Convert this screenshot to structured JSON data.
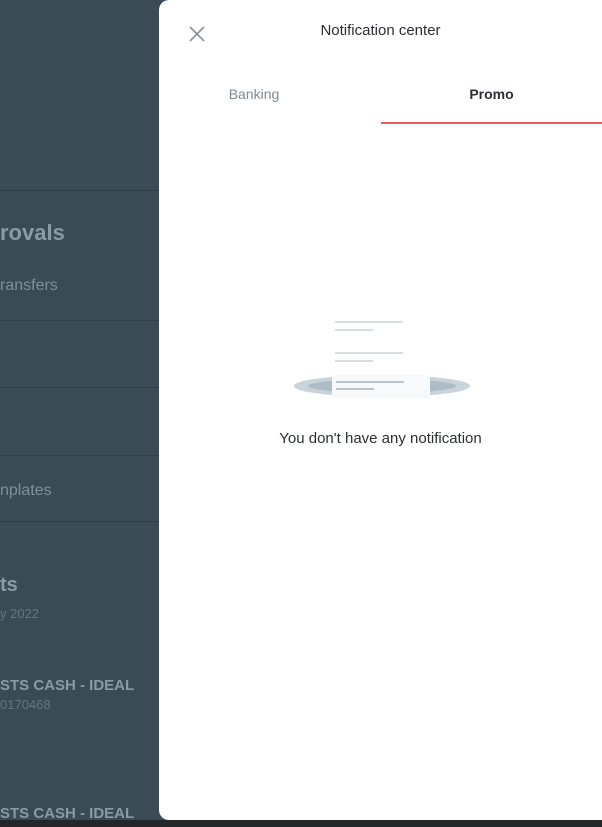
{
  "background": {
    "section_heading": "rovals",
    "subtitle": "ransfers",
    "templates_label": "nplates",
    "stats_heading": "ts",
    "stats_date": "y 2022",
    "transaction_1_name": "STS CASH - IDEAL",
    "transaction_1_ref": "0170468",
    "transaction_2_name": "STS CASH - IDEAL"
  },
  "panel": {
    "title": "Notification center",
    "close_icon": "close-icon",
    "tabs": [
      {
        "label": "Banking",
        "active": false
      },
      {
        "label": "Promo",
        "active": true
      }
    ],
    "empty_icon": "empty-notifications-illustration",
    "empty_message": "You don't have any notification"
  },
  "colors": {
    "overlay": "#3a4b55",
    "panel_bg": "#ffffff",
    "active_tab_underline": "#e35c66",
    "text_primary": "#2b2f33",
    "text_secondary": "#808a90"
  }
}
